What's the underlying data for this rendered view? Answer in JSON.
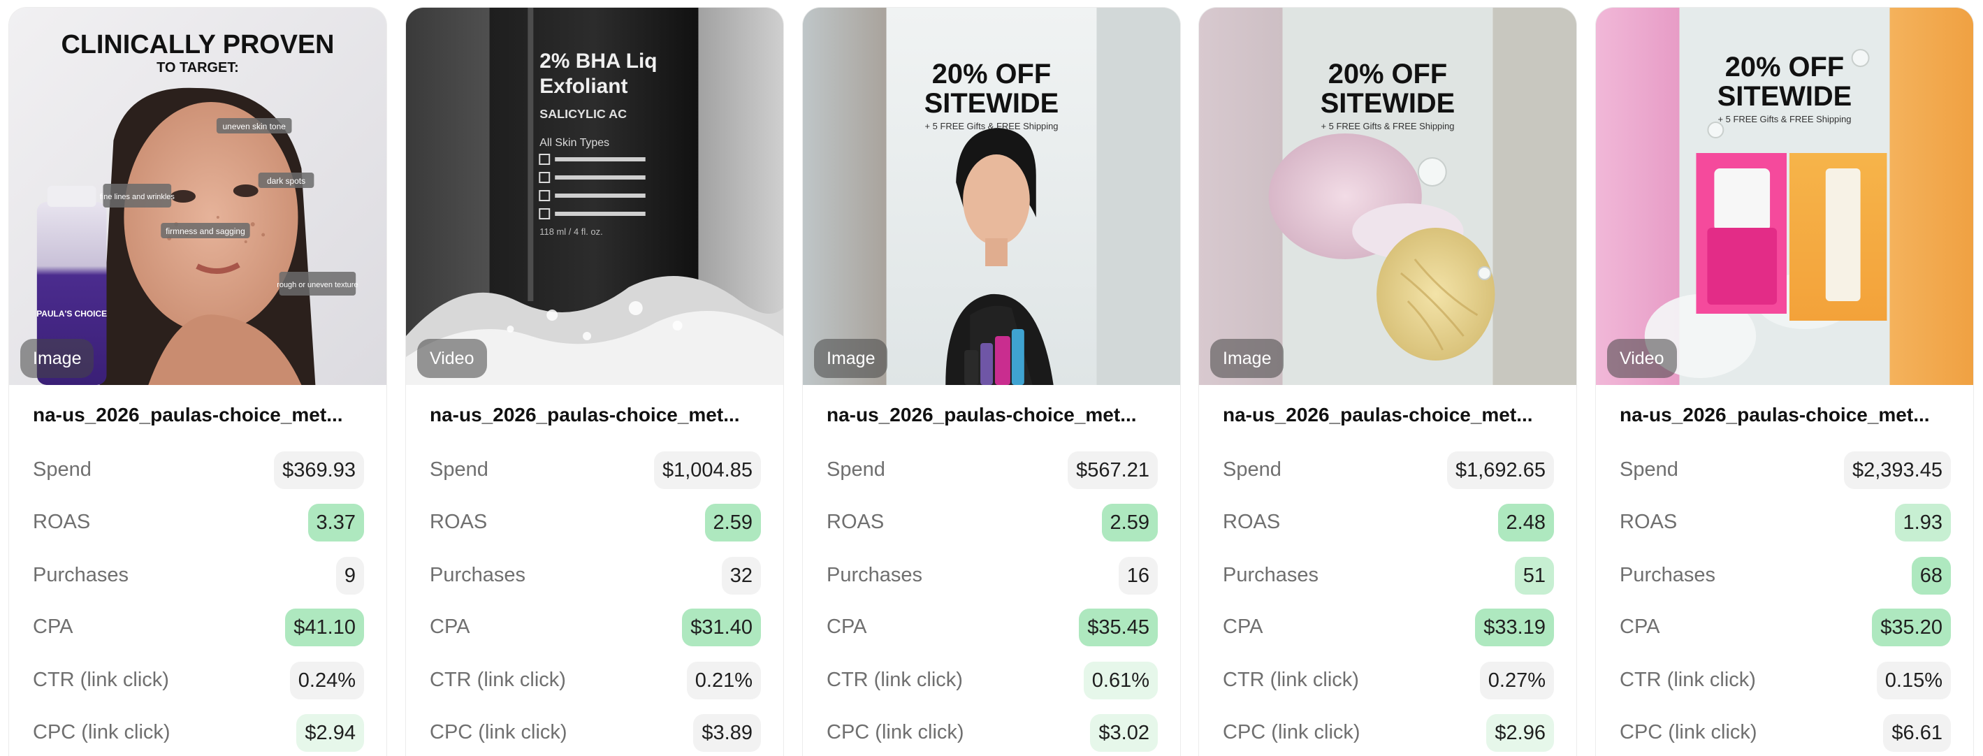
{
  "cards": [
    {
      "badge": "Image",
      "name": "na-us_2026_paulas-choice_met...",
      "thumb_text": {
        "headline": "CLINICALLY PROVEN",
        "subhead": "TO TARGET:",
        "tags": [
          "uneven skin tone",
          "fine lines and wrinkles",
          "dark spots",
          "firmness and sagging",
          "rough or uneven texture"
        ],
        "brand": "PAULA'S CHOICE"
      },
      "metrics": {
        "spend": {
          "label": "Spend",
          "value": "$369.93",
          "tone": "neutral"
        },
        "roas": {
          "label": "ROAS",
          "value": "3.37",
          "tone": "green-strong"
        },
        "purchases": {
          "label": "Purchases",
          "value": "9",
          "tone": "neutral"
        },
        "cpa": {
          "label": "CPA",
          "value": "$41.10",
          "tone": "green-strong"
        },
        "ctr": {
          "label": "CTR (link click)",
          "value": "0.24%",
          "tone": "neutral"
        },
        "cpc": {
          "label": "CPC (link click)",
          "value": "$2.94",
          "tone": "green-light"
        }
      }
    },
    {
      "badge": "Video",
      "name": "na-us_2026_paulas-choice_met...",
      "thumb_text": {
        "line1": "2% BHA Liq",
        "line2": "Exfoliant",
        "line3": "SALICYLIC AC",
        "line4": "All Skin Types",
        "line5": "118 ml / 4 fl. oz."
      },
      "metrics": {
        "spend": {
          "label": "Spend",
          "value": "$1,004.85",
          "tone": "neutral"
        },
        "roas": {
          "label": "ROAS",
          "value": "2.59",
          "tone": "green-strong"
        },
        "purchases": {
          "label": "Purchases",
          "value": "32",
          "tone": "neutral"
        },
        "cpa": {
          "label": "CPA",
          "value": "$31.40",
          "tone": "green-strong"
        },
        "ctr": {
          "label": "CTR (link click)",
          "value": "0.21%",
          "tone": "neutral"
        },
        "cpc": {
          "label": "CPC (link click)",
          "value": "$3.89",
          "tone": "neutral"
        }
      }
    },
    {
      "badge": "Image",
      "name": "na-us_2026_paulas-choice_met...",
      "thumb_text": {
        "line1": "20% OFF",
        "line2": "SITEWIDE",
        "line3": "+ 5 FREE Gifts & FREE Shipping"
      },
      "metrics": {
        "spend": {
          "label": "Spend",
          "value": "$567.21",
          "tone": "neutral"
        },
        "roas": {
          "label": "ROAS",
          "value": "2.59",
          "tone": "green-strong"
        },
        "purchases": {
          "label": "Purchases",
          "value": "16",
          "tone": "neutral"
        },
        "cpa": {
          "label": "CPA",
          "value": "$35.45",
          "tone": "green-strong"
        },
        "ctr": {
          "label": "CTR (link click)",
          "value": "0.61%",
          "tone": "green-faint"
        },
        "cpc": {
          "label": "CPC (link click)",
          "value": "$3.02",
          "tone": "green-light"
        }
      }
    },
    {
      "badge": "Image",
      "name": "na-us_2026_paulas-choice_met...",
      "thumb_text": {
        "line1": "20% OFF",
        "line2": "SITEWIDE",
        "line3": "+ 5 FREE Gifts & FREE Shipping"
      },
      "metrics": {
        "spend": {
          "label": "Spend",
          "value": "$1,692.65",
          "tone": "neutral"
        },
        "roas": {
          "label": "ROAS",
          "value": "2.48",
          "tone": "green-strong"
        },
        "purchases": {
          "label": "Purchases",
          "value": "51",
          "tone": "green-light"
        },
        "cpa": {
          "label": "CPA",
          "value": "$33.19",
          "tone": "green-strong"
        },
        "ctr": {
          "label": "CTR (link click)",
          "value": "0.27%",
          "tone": "neutral"
        },
        "cpc": {
          "label": "CPC (link click)",
          "value": "$2.96",
          "tone": "green-faint"
        }
      }
    },
    {
      "badge": "Video",
      "name": "na-us_2026_paulas-choice_met...",
      "thumb_text": {
        "line1": "20% OFF",
        "line2": "SITEWIDE",
        "line3": "+ 5 FREE Gifts & FREE Shipping"
      },
      "metrics": {
        "spend": {
          "label": "Spend",
          "value": "$2,393.45",
          "tone": "neutral"
        },
        "roas": {
          "label": "ROAS",
          "value": "1.93",
          "tone": "green-light"
        },
        "purchases": {
          "label": "Purchases",
          "value": "68",
          "tone": "green-strong"
        },
        "cpa": {
          "label": "CPA",
          "value": "$35.20",
          "tone": "green-strong"
        },
        "ctr": {
          "label": "CTR (link click)",
          "value": "0.15%",
          "tone": "neutral"
        },
        "cpc": {
          "label": "CPC (link click)",
          "value": "$6.61",
          "tone": "neutral"
        }
      }
    }
  ]
}
